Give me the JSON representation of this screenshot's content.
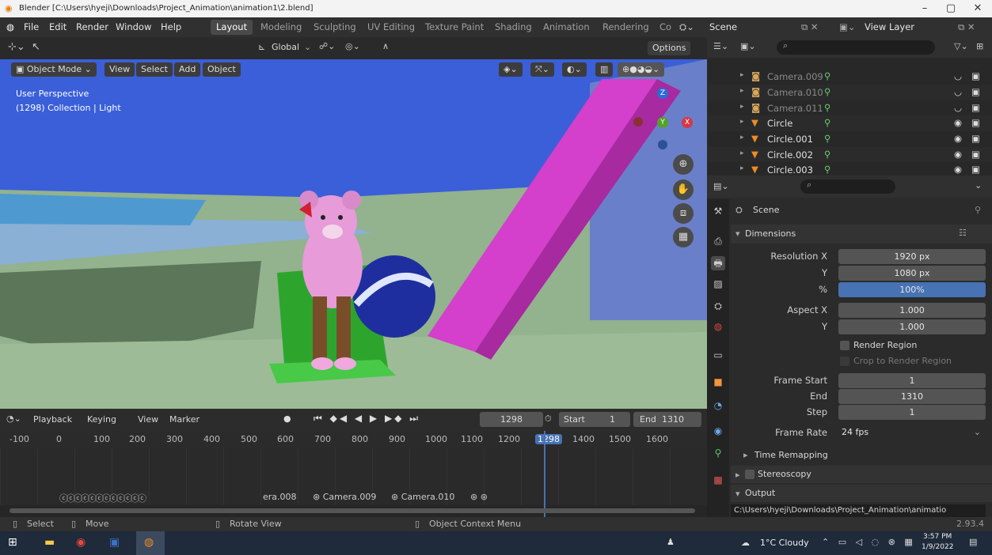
{
  "titlebar": {
    "title": "Blender [C:\\Users\\hyeji\\Downloads\\Project_Animation\\animation1\\2.blend]"
  },
  "menu": {
    "items": [
      "File",
      "Edit",
      "Render",
      "Window",
      "Help"
    ]
  },
  "workspaces": {
    "tabs": [
      "Layout",
      "Modeling",
      "Sculpting",
      "UV Editing",
      "Texture Paint",
      "Shading",
      "Animation",
      "Rendering",
      "Co"
    ],
    "active": "Layout"
  },
  "scene": {
    "name": "Scene",
    "view_layer": "View Layer"
  },
  "viewport": {
    "orientation": "Global",
    "options": "Options",
    "mode": "Object Mode",
    "menus": [
      "View",
      "Select",
      "Add",
      "Object"
    ],
    "overlay_line1": "User Perspective",
    "overlay_line2": "(1298) Collection | Light",
    "gizmo": {
      "z": "Z",
      "y": "Y",
      "x": "X"
    }
  },
  "outliner": {
    "rows": [
      {
        "name": "Camera.009",
        "type": "camera"
      },
      {
        "name": "Camera.010",
        "type": "camera"
      },
      {
        "name": "Camera.011",
        "type": "camera"
      },
      {
        "name": "Circle",
        "type": "mesh"
      },
      {
        "name": "Circle.001",
        "type": "mesh"
      },
      {
        "name": "Circle.002",
        "type": "mesh"
      },
      {
        "name": "Circle.003",
        "type": "mesh"
      }
    ]
  },
  "properties": {
    "context": "Scene",
    "dimensions_label": "Dimensions",
    "resolution_x_label": "Resolution X",
    "resolution_x": "1920 px",
    "y_label": "Y",
    "resolution_y": "1080 px",
    "pct_label": "%",
    "resolution_pct": "100%",
    "aspect_x_label": "Aspect X",
    "aspect_x": "1.000",
    "aspect_y_label": "Y",
    "aspect_y": "1.000",
    "render_region": "Render Region",
    "crop_region": "Crop to Render Region",
    "frame_start_label": "Frame Start",
    "frame_start": "1",
    "end_label": "End",
    "frame_end": "1310",
    "step_label": "Step",
    "frame_step": "1",
    "frame_rate_label": "Frame Rate",
    "frame_rate": "24 fps",
    "time_remapping": "Time Remapping",
    "stereoscopy": "Stereoscopy",
    "output": "Output",
    "output_path": "C:\\Users\\hyeji\\Downloads\\Project_Animation\\animatio"
  },
  "timeline": {
    "menus": [
      "Playback",
      "Keying",
      "View",
      "Marker"
    ],
    "current_frame": "1298",
    "start_label": "Start",
    "start": "1",
    "end_label": "End",
    "end": "1310",
    "ruler": [
      "-100",
      "0",
      "100",
      "200",
      "300",
      "400",
      "500",
      "600",
      "700",
      "800",
      "900",
      "1000",
      "1100",
      "1200",
      "1298",
      "1400",
      "1500",
      "1600"
    ],
    "markers": [
      "era.008",
      "Camera.009",
      "Camera.010"
    ]
  },
  "statusbar": {
    "select": "Select",
    "move": "Move",
    "rotate": "Rotate View",
    "context_menu": "Object Context Menu",
    "version": "2.93.4"
  },
  "taskbar": {
    "weather": "1°C  Cloudy",
    "time": "3:57 PM",
    "date": "1/9/2022"
  },
  "colors": {
    "accent": "#4772b3",
    "active_frame": "#4772b3",
    "bg_dark": "#1d1d1d"
  }
}
